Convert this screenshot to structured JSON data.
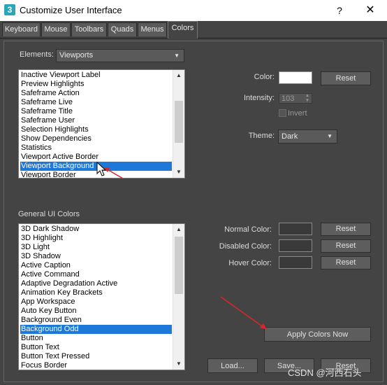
{
  "window": {
    "title": "Customize User Interface",
    "app_icon": "3",
    "help": "?",
    "close": "✕"
  },
  "tabs": [
    "Keyboard",
    "Mouse",
    "Toolbars",
    "Quads",
    "Menus",
    "Colors"
  ],
  "active_tab": "Colors",
  "elements": {
    "label": "Elements:",
    "value": "Viewports",
    "arrow": "▼"
  },
  "viewports_list": {
    "items": [
      "Inactive Viewport Label",
      "Preview Highlights",
      "Safeframe Action",
      "Safeframe Live",
      "Safeframe Title",
      "Safeframe User",
      "Selection Highlights",
      "Show Dependencies",
      "Statistics",
      "Viewport Active Border",
      "Viewport Background",
      "Viewport Border"
    ],
    "selected": "Viewport Background"
  },
  "color": {
    "label": "Color:",
    "swatch": "#ffffff",
    "reset": "Reset"
  },
  "intensity": {
    "label": "Intensity:",
    "value": "103"
  },
  "invert": {
    "label": "Invert"
  },
  "theme": {
    "label": "Theme:",
    "value": "Dark",
    "arrow": "▼"
  },
  "general_ui": {
    "label": "General UI Colors",
    "items": [
      "3D Dark Shadow",
      "3D Highlight",
      "3D Light",
      "3D Shadow",
      "Active Caption",
      "Active Command",
      "Adaptive Degradation Active",
      "Animation Key Brackets",
      "App Workspace",
      "Auto Key Button",
      "Background Even",
      "Background Odd",
      "Button",
      "Button Text",
      "Button Text Pressed",
      "Focus Border"
    ],
    "selected": "Background Odd"
  },
  "normal_color": {
    "label": "Normal Color:",
    "swatch": "#3a3a3a",
    "reset": "Reset"
  },
  "disabled_color": {
    "label": "Disabled Color:",
    "swatch": "#3a3a3a",
    "reset": "Reset"
  },
  "hover_color": {
    "label": "Hover Color:",
    "swatch": "#3a3a3a",
    "reset": "Reset"
  },
  "apply_colors": "Apply Colors Now",
  "bottom_buttons": {
    "load": "Load...",
    "save": "Save...",
    "reset": "Reset"
  },
  "watermark": "CSDN @河西石头",
  "colors": {
    "background": "#444444",
    "selection": "#1e78d7",
    "annotation_arrow": "#d9262c"
  }
}
